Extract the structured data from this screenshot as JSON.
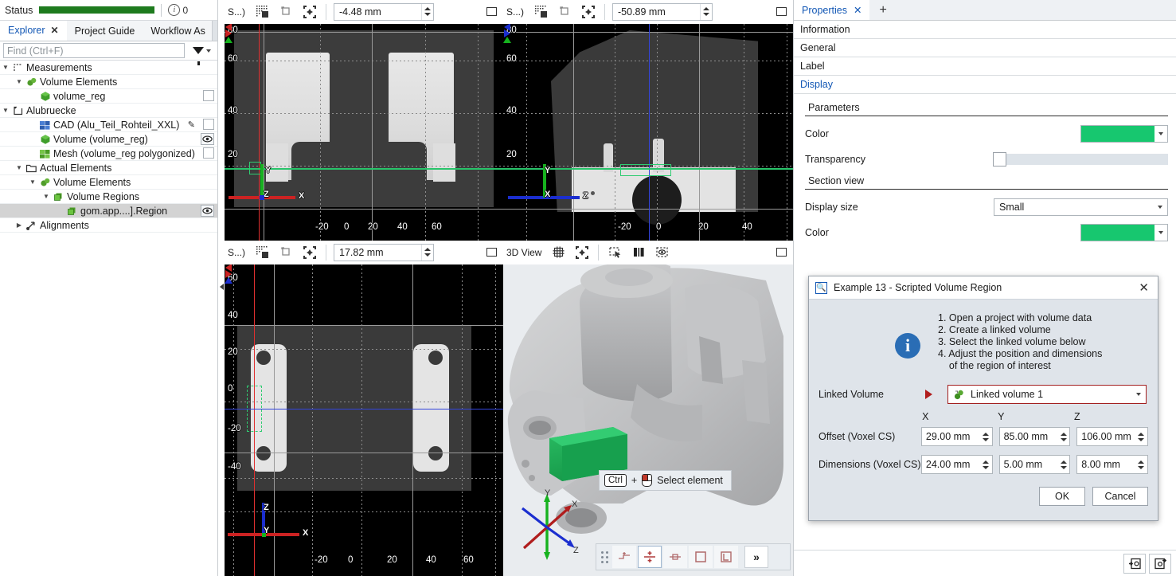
{
  "status": {
    "label": "Status",
    "info_count": "0",
    "progress_pct": 100
  },
  "explorer": {
    "tabs": [
      {
        "label": "Explorer",
        "active": true,
        "closable": true
      },
      {
        "label": "Project Guide",
        "active": false,
        "closable": false
      },
      {
        "label": "Workflow As",
        "active": false,
        "closable": false
      }
    ],
    "find_placeholder": "Find (Ctrl+F)",
    "find_value": "",
    "tree": [
      {
        "label": "Measurements",
        "indent": 0,
        "twisty": "down",
        "icon": "measurements-icon",
        "right": ""
      },
      {
        "label": "Volume Elements",
        "indent": 1,
        "twisty": "down",
        "icon": "volume-elements-icon",
        "right": ""
      },
      {
        "label": "volume_reg",
        "indent": 2,
        "twisty": "none",
        "icon": "volume-icon",
        "right": "checkbox"
      },
      {
        "label": "Alubruecke",
        "indent": 0,
        "twisty": "down",
        "icon": "project-icon",
        "right": ""
      },
      {
        "label": "CAD (Alu_Teil_Rohteil_XXL)",
        "indent": 2,
        "twisty": "none",
        "icon": "cad-icon",
        "right": "pencil-checkbox"
      },
      {
        "label": "Volume (volume_reg)",
        "indent": 2,
        "twisty": "none",
        "icon": "volume-icon",
        "right": "eye"
      },
      {
        "label": "Mesh (volume_reg polygonized)",
        "indent": 2,
        "twisty": "none",
        "icon": "mesh-icon",
        "right": "checkbox"
      },
      {
        "label": "Actual Elements",
        "indent": 1,
        "twisty": "down",
        "icon": "folder-icon",
        "right": ""
      },
      {
        "label": "Volume Elements",
        "indent": 2,
        "twisty": "down",
        "icon": "volume-elements-icon",
        "right": ""
      },
      {
        "label": "Volume Regions",
        "indent": 3,
        "twisty": "down",
        "icon": "volume-region-icon",
        "right": ""
      },
      {
        "label": "gom.app....].Region",
        "indent": 4,
        "twisty": "none",
        "icon": "volume-region-icon",
        "right": "eye",
        "selected": true
      },
      {
        "label": "Alignments",
        "indent": 1,
        "twisty": "right",
        "icon": "alignments-icon",
        "right": ""
      }
    ]
  },
  "viewports": [
    {
      "id": "vp-top-left",
      "title": "S...)",
      "slice_value": "-4.48 mm",
      "view_type": "2d-slice",
      "x_ticks": [
        "-20",
        "0",
        "20",
        "40",
        "60"
      ],
      "y_ticks": [
        "80",
        "60",
        "40",
        "20"
      ],
      "axes": {
        "up": "Y",
        "right": "X",
        "origin": "Z"
      }
    },
    {
      "id": "vp-top-right",
      "title": "S...)",
      "slice_value": "-50.89 mm",
      "view_type": "2d-slice",
      "x_ticks": [
        "-20",
        "0",
        "20",
        "40"
      ],
      "y_ticks": [
        "80",
        "60",
        "40",
        "20"
      ],
      "axes": {
        "up": "Y",
        "right": "Z",
        "origin": "X"
      }
    },
    {
      "id": "vp-bottom-left",
      "title": "S...)",
      "slice_value": "17.82 mm",
      "view_type": "2d-slice",
      "x_ticks": [
        "-20",
        "0",
        "20",
        "40",
        "60"
      ],
      "y_ticks": [
        "60",
        "40",
        "20",
        "0",
        "-20",
        "-40"
      ],
      "axes": {
        "up": "Z",
        "right": "X",
        "origin": "Y"
      }
    },
    {
      "id": "vp-3d",
      "title": "3D View",
      "view_type": "3d",
      "axes": {
        "up": "Y",
        "right": "X",
        "depth": "Z"
      }
    }
  ],
  "view3d": {
    "hint": {
      "key": "Ctrl",
      "plus": "+",
      "mouse_icon": "mouse-left-click-icon",
      "text": "Select element"
    },
    "float_toolbar": [
      {
        "name": "section-plane-icon",
        "active": false
      },
      {
        "name": "section-clip-icon",
        "active": true
      },
      {
        "name": "section-slab-icon",
        "active": false
      },
      {
        "name": "section-box-icon",
        "active": false
      },
      {
        "name": "section-corner-icon",
        "active": false
      },
      {
        "name": "overflow-chevron-icon",
        "active": false,
        "label": "»"
      }
    ]
  },
  "properties": {
    "tabs": [
      {
        "label": "Properties",
        "active": true
      }
    ],
    "add_tab_label": "+",
    "sections": [
      {
        "label": "Information",
        "link": false
      },
      {
        "label": "General",
        "link": false
      },
      {
        "label": "Label",
        "link": false
      },
      {
        "label": "Display",
        "link": true
      }
    ],
    "groups": [
      {
        "title": "Parameters",
        "rows": [
          {
            "label": "Color",
            "type": "color",
            "value": "#17c76f"
          },
          {
            "label": "Transparency",
            "type": "slider",
            "value": 0
          }
        ]
      },
      {
        "title": "Section view",
        "rows": [
          {
            "label": "Display size",
            "type": "combo",
            "value": "Small"
          },
          {
            "label": "Color",
            "type": "color",
            "value": "#17c76f"
          }
        ]
      }
    ],
    "bottom_buttons": [
      {
        "name": "import-settings-icon"
      },
      {
        "name": "export-settings-icon"
      }
    ]
  },
  "dialog": {
    "icon": "search-script-icon",
    "title": "Example 13 - Scripted Volume Region",
    "close_label": "✕",
    "info_icon": "info-icon",
    "steps": [
      "1. Open a project with volume data",
      "2. Create a linked volume",
      "3. Select the linked volume below",
      "4. Adjust the position and dimensions",
      "    of the region of interest"
    ],
    "linked_volume": {
      "label": "Linked Volume",
      "marker": "red-triangle-icon",
      "item_icon": "linked-volume-icon",
      "value": "Linked volume 1"
    },
    "axis_headers": [
      "X",
      "Y",
      "Z"
    ],
    "rows": [
      {
        "label": "Offset (Voxel CS)",
        "values": [
          "29.00 mm",
          "85.00 mm",
          "106.00 mm"
        ]
      },
      {
        "label": "Dimensions (Voxel CS)",
        "values": [
          "24.00 mm",
          "5.00 mm",
          "8.00 mm"
        ]
      }
    ],
    "ok_label": "OK",
    "cancel_label": "Cancel"
  },
  "colors": {
    "accent_green": "#17c76f",
    "roi_green": "#2ecc71",
    "status_green": "#1e7b1e",
    "link_blue": "#1257b5",
    "dialog_red": "#a31f1f",
    "info_blue": "#2a6db5"
  }
}
